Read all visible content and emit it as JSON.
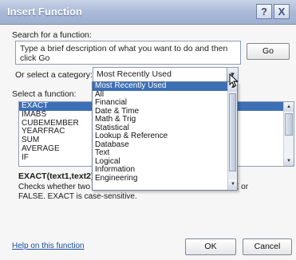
{
  "window": {
    "title": "Insert Function"
  },
  "titlebar": {
    "help_icon": "?",
    "close_icon": "X"
  },
  "search": {
    "label": "Search for a function:",
    "value": "Type a brief description of what you want to do and then click Go",
    "go_label": "Go"
  },
  "category": {
    "label": "Or select a category:",
    "selected": "Most Recently Used",
    "options": [
      "Most Recently Used",
      "All",
      "Financial",
      "Date & Time",
      "Math & Trig",
      "Statistical",
      "Lookup & Reference",
      "Database",
      "Text",
      "Logical",
      "Information",
      "Engineering"
    ]
  },
  "functions": {
    "label": "Select a function:",
    "items": [
      "EXACT",
      "IMABS",
      "CUBEMEMBER",
      "YEARFRAC",
      "SUM",
      "AVERAGE",
      "IF"
    ],
    "selected": "EXACT"
  },
  "description": {
    "signature": "EXACT(text1,text2)",
    "text_start": "Checks whether two t",
    "text_end": "ns TRUE or",
    "text_line2": "FALSE. EXACT is case-sensitive."
  },
  "footer": {
    "help_link": "Help on this function",
    "ok_label": "OK",
    "cancel_label": "Cancel"
  },
  "icons": {
    "combo_arrow": "chevron-down-icon",
    "scroll_up": "chevron-up-icon",
    "scroll_down": "chevron-down-icon",
    "cursor": "pointer-cursor-icon"
  },
  "colors": {
    "title_bar": "#a9b8d6",
    "selection": "#3d6fb5",
    "link": "#1f4ea3"
  }
}
